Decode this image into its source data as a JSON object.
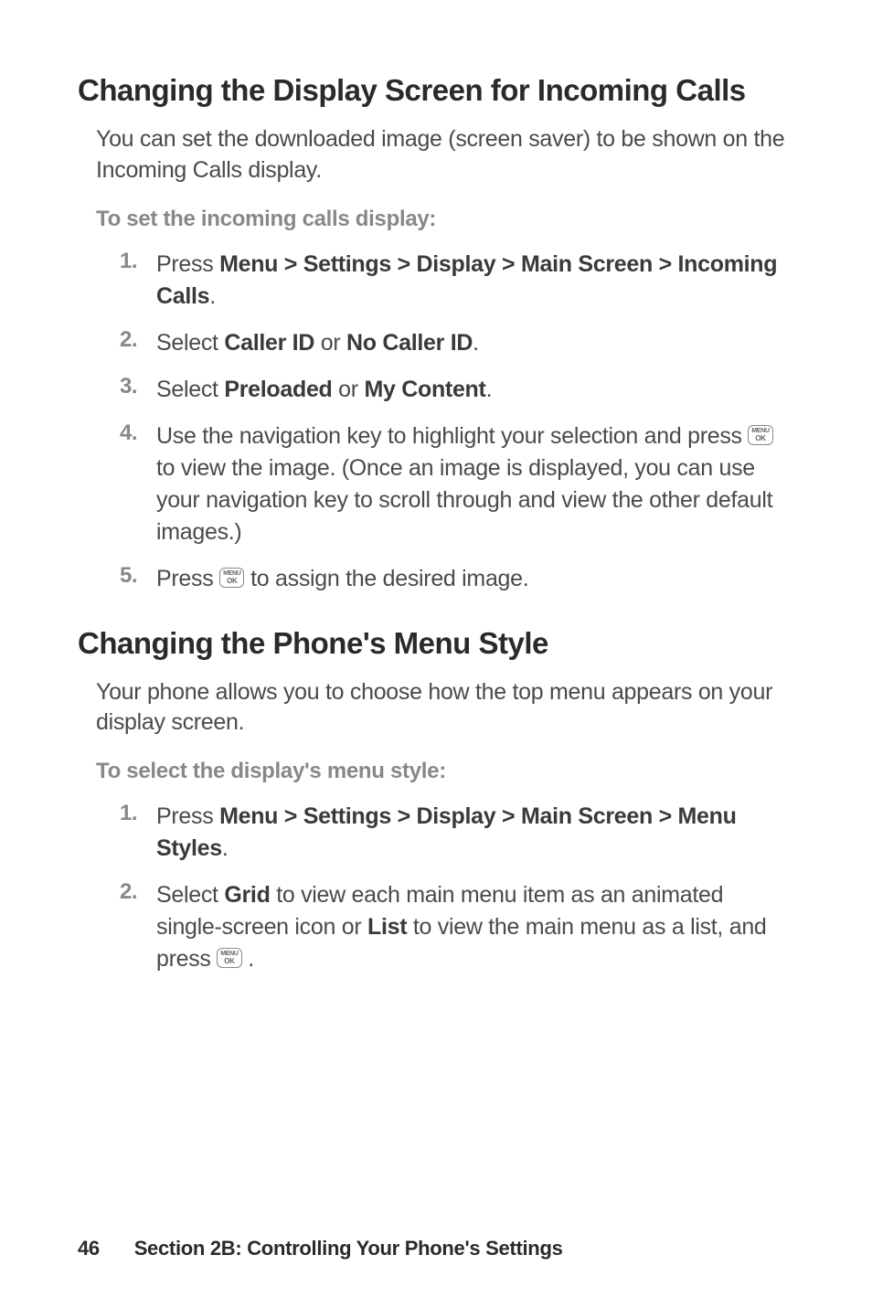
{
  "section1": {
    "heading": "Changing the Display Screen for Incoming Calls",
    "intro": "You can set the downloaded image (screen saver) to be shown on the Incoming Calls display.",
    "subheading": "To set the incoming calls display:",
    "steps": [
      {
        "num": "1.",
        "pre": "Press ",
        "bold": "Menu > Settings > Display > Main Screen > Incoming Calls",
        "post": "."
      },
      {
        "num": "2.",
        "pre": "Select ",
        "bold": "Caller ID",
        "mid": " or ",
        "bold2": "No Caller ID",
        "post": "."
      },
      {
        "num": "3.",
        "pre": "Select ",
        "bold": "Preloaded",
        "mid": " or ",
        "bold2": "My Content",
        "post": "."
      },
      {
        "num": "4.",
        "pre": "Use the navigation key to highlight your selection and press ",
        "icon": true,
        "post": " to view the image. (Once an image is displayed, you can use your navigation key to scroll through and view the other default images.)"
      },
      {
        "num": "5.",
        "pre": "Press ",
        "icon": true,
        "post": " to assign the desired image."
      }
    ]
  },
  "section2": {
    "heading": "Changing the Phone's Menu Style",
    "intro": "Your phone allows you to choose how the top menu appears on your display screen.",
    "subheading": "To select the display's menu style:",
    "steps": [
      {
        "num": "1.",
        "pre": "Press ",
        "bold": "Menu > Settings > Display > Main Screen > Menu Styles",
        "post": "."
      },
      {
        "num": "2.",
        "pre": "Select ",
        "bold": "Grid",
        "mid": " to view each main menu item as an animated single-screen icon or ",
        "bold2": "List",
        "post2": " to view the main menu as a list, and press ",
        "icon": true,
        "post": " ."
      }
    ]
  },
  "footer": {
    "page": "46",
    "title": "Section 2B: Controlling Your Phone's Settings"
  },
  "icon": {
    "menu": "MENU",
    "ok": "OK"
  }
}
